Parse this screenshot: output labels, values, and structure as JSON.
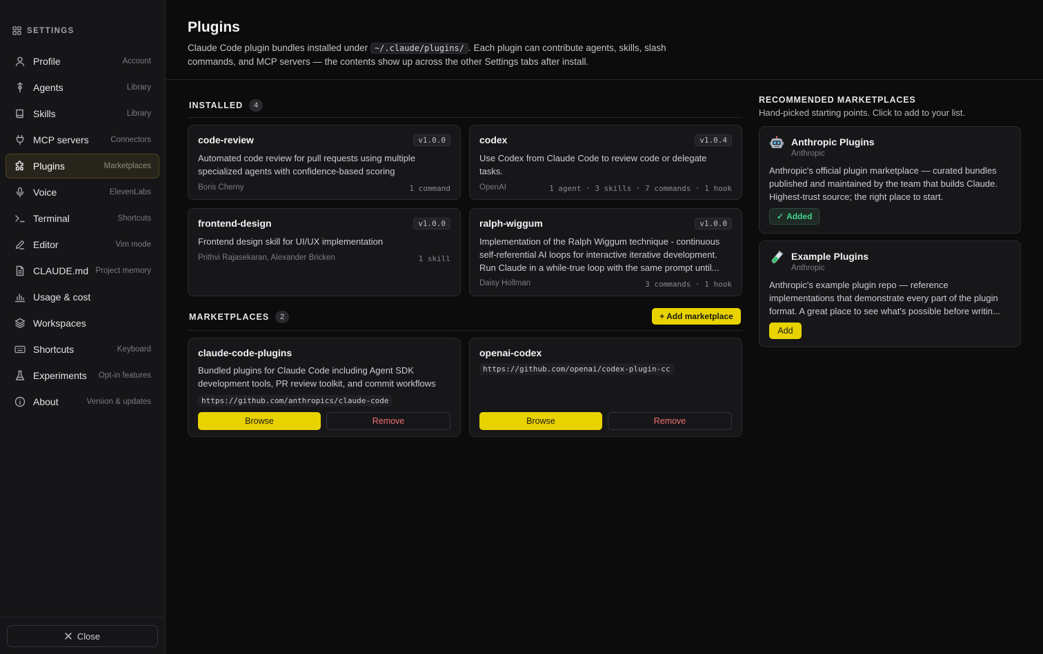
{
  "sidebar": {
    "header": "SETTINGS",
    "items": [
      {
        "label": "Profile",
        "sub": "Account",
        "icon": "user-icon"
      },
      {
        "label": "Agents",
        "sub": "Library",
        "icon": "agent-icon"
      },
      {
        "label": "Skills",
        "sub": "Library",
        "icon": "book-icon"
      },
      {
        "label": "MCP servers",
        "sub": "Connectors",
        "icon": "plug-icon"
      },
      {
        "label": "Plugins",
        "sub": "Marketplaces",
        "icon": "puzzle-icon"
      },
      {
        "label": "Voice",
        "sub": "ElevenLabs",
        "icon": "mic-icon"
      },
      {
        "label": "Terminal",
        "sub": "Shortcuts",
        "icon": "terminal-icon"
      },
      {
        "label": "Editor",
        "sub": "Vim mode",
        "icon": "pencil-icon"
      },
      {
        "label": "CLAUDE.md",
        "sub": "Project memory",
        "icon": "file-icon"
      },
      {
        "label": "Usage & cost",
        "sub": "",
        "icon": "chart-icon"
      },
      {
        "label": "Workspaces",
        "sub": "",
        "icon": "layers-icon"
      },
      {
        "label": "Shortcuts",
        "sub": "Keyboard",
        "icon": "keyboard-icon"
      },
      {
        "label": "Experiments",
        "sub": "Opt-in features",
        "icon": "flask-icon"
      },
      {
        "label": "About",
        "sub": "Version & updates",
        "icon": "info-icon"
      }
    ],
    "close_label": "Close"
  },
  "header": {
    "title": "Plugins",
    "desc_before": "Claude Code plugin bundles installed under ",
    "desc_code": "~/.claude/plugins/",
    "desc_after": ". Each plugin can contribute agents, skills, slash commands, and MCP servers — the contents show up across the other Settings tabs after install."
  },
  "installed": {
    "label": "INSTALLED",
    "count": "4",
    "plugins": [
      {
        "name": "code-review",
        "version": "v1.0.0",
        "desc": "Automated code review for pull requests using multiple specialized agents with confidence-based scoring",
        "author": "Boris Cherny",
        "meta": "1 command"
      },
      {
        "name": "codex",
        "version": "v1.0.4",
        "desc": "Use Codex from Claude Code to review code or delegate tasks.",
        "author": "OpenAI",
        "meta": "1 agent · 3 skills · 7 commands · 1 hook"
      },
      {
        "name": "frontend-design",
        "version": "v1.0.0",
        "desc": "Frontend design skill for UI/UX implementation",
        "author": "Prithvi Rajasekaran, Alexander Bricken",
        "meta": "1 skill"
      },
      {
        "name": "ralph-wiggum",
        "version": "v1.0.0",
        "desc": "Implementation of the Ralph Wiggum technique - continuous self-referential AI loops for interactive iterative development. Run Claude in a while-true loop with the same prompt until...",
        "author": "Daisy Hollman",
        "meta": "3 commands · 1 hook"
      }
    ]
  },
  "marketplaces": {
    "label": "MARKETPLACES",
    "count": "2",
    "add_label": "+ Add marketplace",
    "items": [
      {
        "name": "claude-code-plugins",
        "desc": "Bundled plugins for Claude Code including Agent SDK development tools, PR review toolkit, and commit workflows",
        "url": "https://github.com/anthropics/claude-code",
        "browse": "Browse",
        "remove": "Remove"
      },
      {
        "name": "openai-codex",
        "desc": "",
        "url": "https://github.com/openai/codex-plugin-cc",
        "browse": "Browse",
        "remove": "Remove"
      }
    ]
  },
  "recommended": {
    "title": "RECOMMENDED MARKETPLACES",
    "subtitle": "Hand-picked starting points. Click to add to your list.",
    "items": [
      {
        "name": "Anthropic Plugins",
        "publisher": "Anthropic",
        "icon": "robot-icon",
        "desc": "Anthropic's official plugin marketplace — curated bundles published and maintained by the team that builds Claude. Highest-trust source; the right place to start.",
        "action": "Added",
        "status": "added"
      },
      {
        "name": "Example Plugins",
        "publisher": "Anthropic",
        "icon": "test-tube-icon",
        "desc": "Anthropic's example plugin repo — reference implementations that demonstrate every part of the plugin format. A great place to see what's possible before writin...",
        "action": "Add",
        "status": "available"
      }
    ]
  },
  "colors": {
    "accent": "#e8d300",
    "danger": "#f07070",
    "success": "#42d38a",
    "active_bg": "#27251b"
  }
}
